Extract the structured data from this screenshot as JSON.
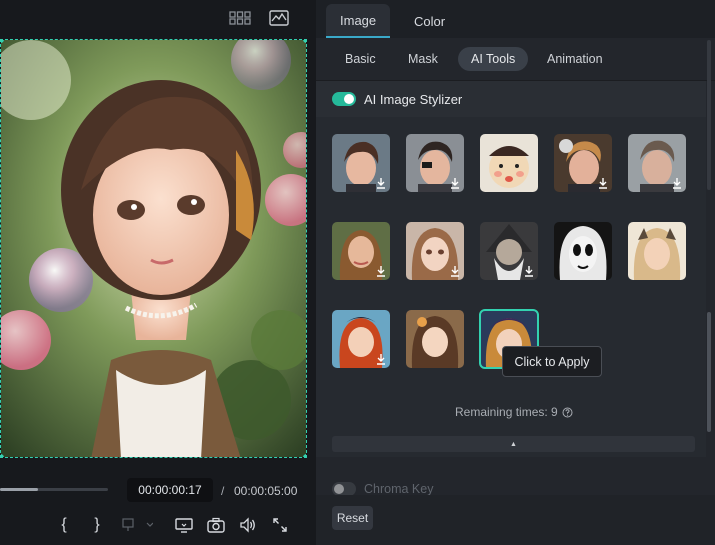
{
  "preview": {
    "timecode_current": "00:00:00:17",
    "time_separator": "/",
    "timecode_total": "00:00:05:00",
    "progress_fraction": 0.35,
    "controls": [
      {
        "name": "mark-in-button",
        "glyph": "{"
      },
      {
        "name": "mark-out-button",
        "glyph": "}"
      }
    ]
  },
  "panel": {
    "tabs": [
      {
        "label": "Image",
        "active": true
      },
      {
        "label": "Color",
        "active": false
      }
    ],
    "subtabs": [
      {
        "label": "Basic",
        "active": false
      },
      {
        "label": "Mask",
        "active": false
      },
      {
        "label": "AI Tools",
        "active": true
      },
      {
        "label": "Animation",
        "active": false
      }
    ],
    "stylizer": {
      "title": "AI Image Stylizer",
      "enabled": true,
      "tooltip": "Click to Apply",
      "remaining_label": "Remaining times: 9",
      "collapse_glyph": "▲"
    },
    "chroma_key": {
      "label": "Chroma Key",
      "enabled": false
    },
    "reset_label": "Reset"
  },
  "colors": {
    "accent": "#33d1b0",
    "toggle_on": "#25b99a",
    "panel_bg": "#23262c"
  }
}
